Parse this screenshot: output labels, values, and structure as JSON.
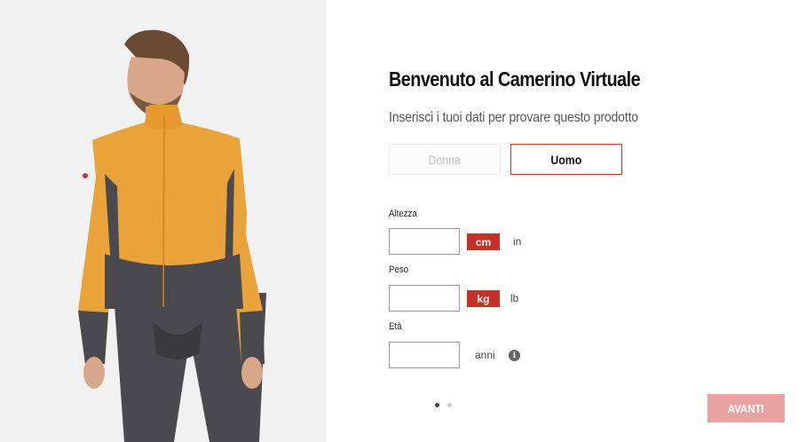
{
  "photo": {
    "description_icon": "product-photo"
  },
  "form": {
    "title": "Benvenuto al Camerino Virtuale",
    "subtitle": "Inserisci i tuoi dati per provare questo prodotto",
    "gender": {
      "female_label": "Donna",
      "male_label": "Uomo",
      "selected": "Uomo"
    },
    "height": {
      "label": "Altezza",
      "value": "",
      "unit_active": "cm",
      "unit_other": "in"
    },
    "weight": {
      "label": "Peso",
      "value": "",
      "unit_active": "kg",
      "unit_other": "lb"
    },
    "age": {
      "label": "Età",
      "value": "",
      "unit": "anni",
      "info_icon": "i"
    },
    "pagination": {
      "current": 1,
      "total": 2
    },
    "next_label": "AVANTI"
  },
  "colors": {
    "accent": "#c8302a",
    "next_disabled": "#e9a3a0",
    "jersey": "#eaa33a",
    "charcoal": "#4a4a4e"
  }
}
